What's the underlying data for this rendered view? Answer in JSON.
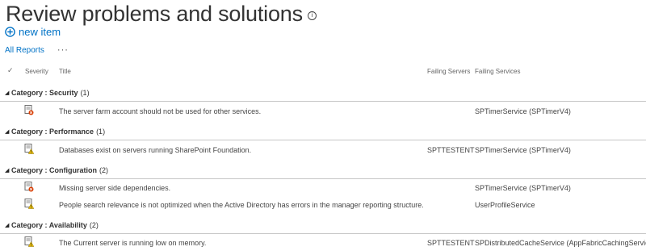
{
  "page": {
    "title": "Review problems and solutions",
    "info_glyph": "i",
    "new_item": "new item",
    "view_label": "All Reports",
    "more": "···"
  },
  "columns": {
    "select": "✓",
    "severity": "Severity",
    "title": "Title",
    "failing_servers": "Failing Servers",
    "failing_services": "Failing Services"
  },
  "groups": [
    {
      "prefix": "Category :",
      "name": "Security",
      "count": "(1)",
      "items": [
        {
          "severity_icon": "error-icon",
          "title": "The server farm account should not be used for other services.",
          "servers": "",
          "services": "SPTimerService (SPTimerV4)"
        }
      ]
    },
    {
      "prefix": "Category :",
      "name": "Performance",
      "count": "(1)",
      "items": [
        {
          "severity_icon": "warning-icon",
          "title": "Databases exist on servers running SharePoint Foundation.",
          "servers": "SPTTESTENT",
          "services": "SPTimerService (SPTimerV4)"
        }
      ]
    },
    {
      "prefix": "Category :",
      "name": "Configuration",
      "count": "(2)",
      "items": [
        {
          "severity_icon": "error-icon",
          "title": "Missing server side dependencies.",
          "servers": "",
          "services": "SPTimerService (SPTimerV4)"
        },
        {
          "severity_icon": "warning-icon",
          "title": "People search relevance is not optimized when the Active Directory has errors in the manager reporting structure.",
          "servers": "",
          "services": "UserProfileService"
        }
      ]
    },
    {
      "prefix": "Category :",
      "name": "Availability",
      "count": "(2)",
      "items": [
        {
          "severity_icon": "warning-icon",
          "title": "The Current server is running low on memory.",
          "servers": "SPTTESTENT",
          "services": "SPDistributedCacheService (AppFabricCachingService)"
        }
      ]
    }
  ],
  "colors": {
    "link": "#0072c6",
    "text": "#444444",
    "divider": "#c6c6c6"
  }
}
